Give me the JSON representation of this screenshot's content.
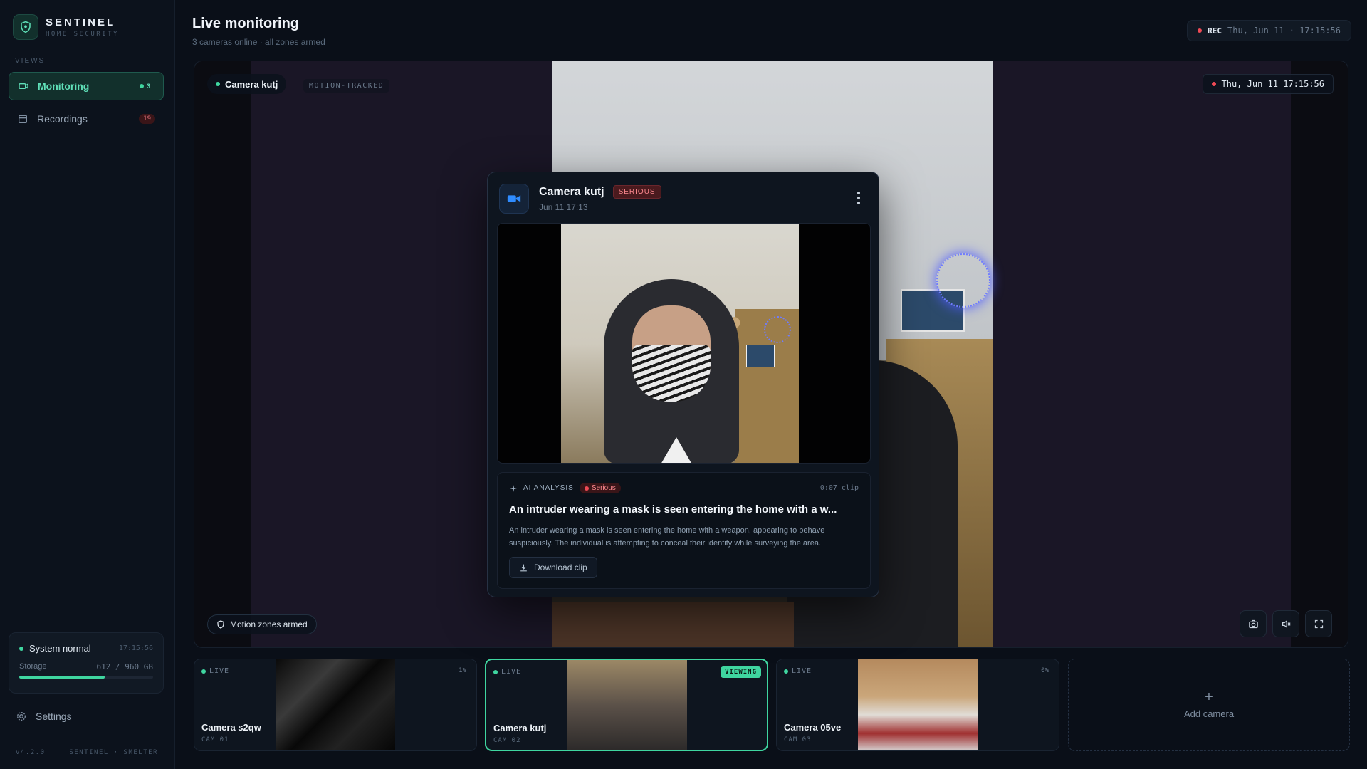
{
  "brand": {
    "name": "SENTINEL",
    "subtitle": "HOME SECURITY"
  },
  "sidebar": {
    "section_label": "VIEWS",
    "items": [
      {
        "label": "Monitoring",
        "badge": "3",
        "icon": "camera-icon",
        "active": true
      },
      {
        "label": "Recordings",
        "badge": "19",
        "icon": "calendar-icon",
        "active": false
      }
    ],
    "system": {
      "status": "System normal",
      "time": "17:15:56",
      "storage_label": "Storage",
      "storage_value": "612 / 960 GB",
      "storage_fraction": 0.6375
    },
    "settings_label": "Settings",
    "footer": {
      "version": "v4.2.0",
      "credit": "SENTINEL · SMELTER"
    }
  },
  "header": {
    "title": "Live monitoring",
    "subtitle": "3 cameras online · all zones armed",
    "rec_label": "REC",
    "datetime": "Thu, Jun 11 · 17:15:56"
  },
  "viewer": {
    "camera": "Camera kutj",
    "mode": "MOTION-TRACKED",
    "timestamp": "Thu, Jun 11 17:15:56",
    "zones": "Motion zones armed"
  },
  "event": {
    "camera": "Camera kutj",
    "severity": "SERIOUS",
    "date": "Jun 11 17:13",
    "ai_label": "AI ANALYSIS",
    "ai_severity": "Serious",
    "clip_length": "0:07 clip",
    "headline": "An intruder wearing a mask is seen entering the home with a w...",
    "description": "An intruder wearing a mask is seen entering the home with a weapon, appearing to behave suspiciously. The individual is attempting to conceal their identity while surveying the area.",
    "download_label": "Download clip"
  },
  "cameras": [
    {
      "live": "LIVE",
      "name": "Camera s2qw",
      "id": "CAM 01",
      "pct": "1%"
    },
    {
      "live": "LIVE",
      "name": "Camera kutj",
      "id": "CAM 02",
      "viewing": "VIEWING"
    },
    {
      "live": "LIVE",
      "name": "Camera 05ve",
      "id": "CAM 03",
      "pct": "0%"
    }
  ],
  "add_camera_label": "Add camera",
  "colors": {
    "accent": "#3fd6a0",
    "danger": "#ef4a55",
    "background": "#0a0f18"
  }
}
